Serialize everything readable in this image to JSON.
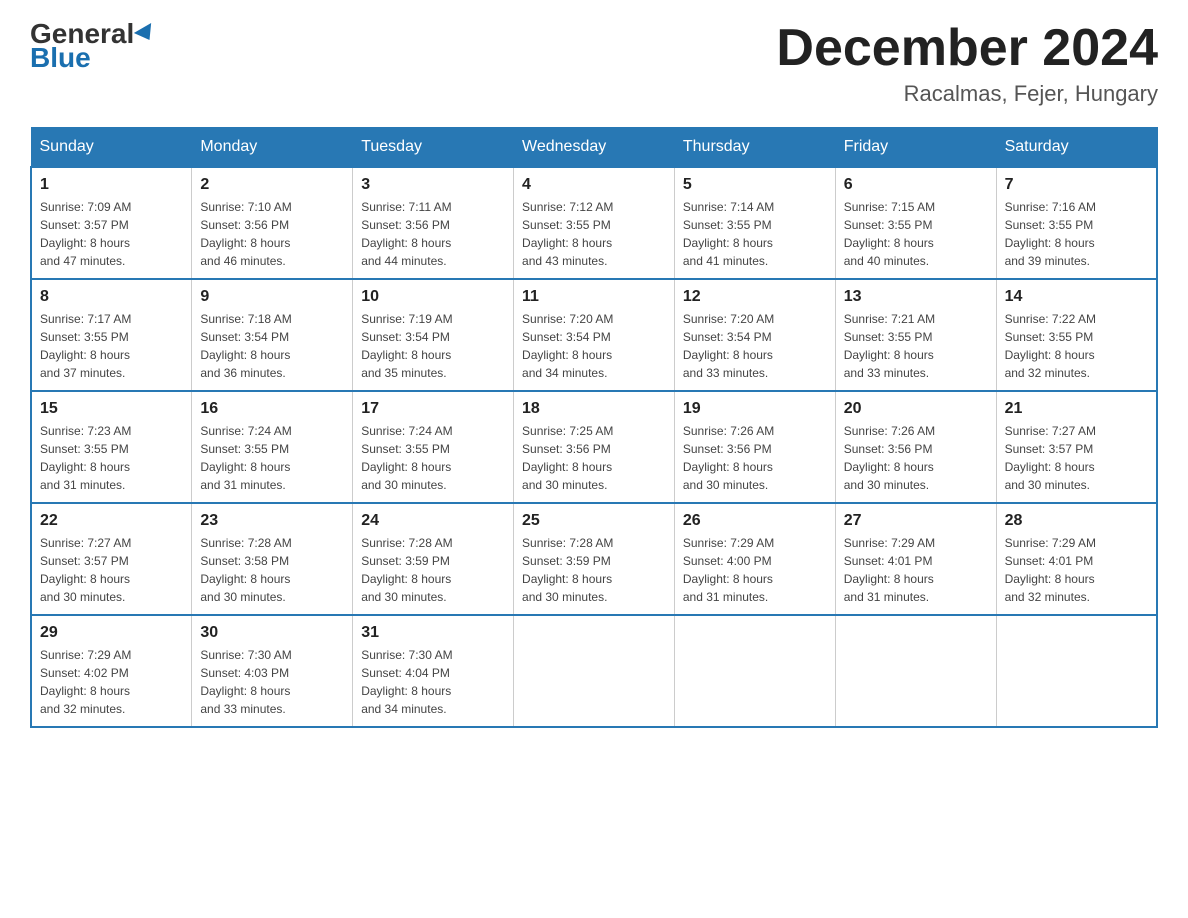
{
  "header": {
    "logo_general": "General",
    "logo_blue": "Blue",
    "month_title": "December 2024",
    "location": "Racalmas, Fejer, Hungary"
  },
  "days_of_week": [
    "Sunday",
    "Monday",
    "Tuesday",
    "Wednesday",
    "Thursday",
    "Friday",
    "Saturday"
  ],
  "weeks": [
    [
      {
        "day": "1",
        "sunrise": "7:09 AM",
        "sunset": "3:57 PM",
        "daylight": "8 hours and 47 minutes."
      },
      {
        "day": "2",
        "sunrise": "7:10 AM",
        "sunset": "3:56 PM",
        "daylight": "8 hours and 46 minutes."
      },
      {
        "day": "3",
        "sunrise": "7:11 AM",
        "sunset": "3:56 PM",
        "daylight": "8 hours and 44 minutes."
      },
      {
        "day": "4",
        "sunrise": "7:12 AM",
        "sunset": "3:55 PM",
        "daylight": "8 hours and 43 minutes."
      },
      {
        "day": "5",
        "sunrise": "7:14 AM",
        "sunset": "3:55 PM",
        "daylight": "8 hours and 41 minutes."
      },
      {
        "day": "6",
        "sunrise": "7:15 AM",
        "sunset": "3:55 PM",
        "daylight": "8 hours and 40 minutes."
      },
      {
        "day": "7",
        "sunrise": "7:16 AM",
        "sunset": "3:55 PM",
        "daylight": "8 hours and 39 minutes."
      }
    ],
    [
      {
        "day": "8",
        "sunrise": "7:17 AM",
        "sunset": "3:55 PM",
        "daylight": "8 hours and 37 minutes."
      },
      {
        "day": "9",
        "sunrise": "7:18 AM",
        "sunset": "3:54 PM",
        "daylight": "8 hours and 36 minutes."
      },
      {
        "day": "10",
        "sunrise": "7:19 AM",
        "sunset": "3:54 PM",
        "daylight": "8 hours and 35 minutes."
      },
      {
        "day": "11",
        "sunrise": "7:20 AM",
        "sunset": "3:54 PM",
        "daylight": "8 hours and 34 minutes."
      },
      {
        "day": "12",
        "sunrise": "7:20 AM",
        "sunset": "3:54 PM",
        "daylight": "8 hours and 33 minutes."
      },
      {
        "day": "13",
        "sunrise": "7:21 AM",
        "sunset": "3:55 PM",
        "daylight": "8 hours and 33 minutes."
      },
      {
        "day": "14",
        "sunrise": "7:22 AM",
        "sunset": "3:55 PM",
        "daylight": "8 hours and 32 minutes."
      }
    ],
    [
      {
        "day": "15",
        "sunrise": "7:23 AM",
        "sunset": "3:55 PM",
        "daylight": "8 hours and 31 minutes."
      },
      {
        "day": "16",
        "sunrise": "7:24 AM",
        "sunset": "3:55 PM",
        "daylight": "8 hours and 31 minutes."
      },
      {
        "day": "17",
        "sunrise": "7:24 AM",
        "sunset": "3:55 PM",
        "daylight": "8 hours and 30 minutes."
      },
      {
        "day": "18",
        "sunrise": "7:25 AM",
        "sunset": "3:56 PM",
        "daylight": "8 hours and 30 minutes."
      },
      {
        "day": "19",
        "sunrise": "7:26 AM",
        "sunset": "3:56 PM",
        "daylight": "8 hours and 30 minutes."
      },
      {
        "day": "20",
        "sunrise": "7:26 AM",
        "sunset": "3:56 PM",
        "daylight": "8 hours and 30 minutes."
      },
      {
        "day": "21",
        "sunrise": "7:27 AM",
        "sunset": "3:57 PM",
        "daylight": "8 hours and 30 minutes."
      }
    ],
    [
      {
        "day": "22",
        "sunrise": "7:27 AM",
        "sunset": "3:57 PM",
        "daylight": "8 hours and 30 minutes."
      },
      {
        "day": "23",
        "sunrise": "7:28 AM",
        "sunset": "3:58 PM",
        "daylight": "8 hours and 30 minutes."
      },
      {
        "day": "24",
        "sunrise": "7:28 AM",
        "sunset": "3:59 PM",
        "daylight": "8 hours and 30 minutes."
      },
      {
        "day": "25",
        "sunrise": "7:28 AM",
        "sunset": "3:59 PM",
        "daylight": "8 hours and 30 minutes."
      },
      {
        "day": "26",
        "sunrise": "7:29 AM",
        "sunset": "4:00 PM",
        "daylight": "8 hours and 31 minutes."
      },
      {
        "day": "27",
        "sunrise": "7:29 AM",
        "sunset": "4:01 PM",
        "daylight": "8 hours and 31 minutes."
      },
      {
        "day": "28",
        "sunrise": "7:29 AM",
        "sunset": "4:01 PM",
        "daylight": "8 hours and 32 minutes."
      }
    ],
    [
      {
        "day": "29",
        "sunrise": "7:29 AM",
        "sunset": "4:02 PM",
        "daylight": "8 hours and 32 minutes."
      },
      {
        "day": "30",
        "sunrise": "7:30 AM",
        "sunset": "4:03 PM",
        "daylight": "8 hours and 33 minutes."
      },
      {
        "day": "31",
        "sunrise": "7:30 AM",
        "sunset": "4:04 PM",
        "daylight": "8 hours and 34 minutes."
      },
      null,
      null,
      null,
      null
    ]
  ],
  "labels": {
    "sunrise": "Sunrise:",
    "sunset": "Sunset:",
    "daylight": "Daylight:"
  }
}
